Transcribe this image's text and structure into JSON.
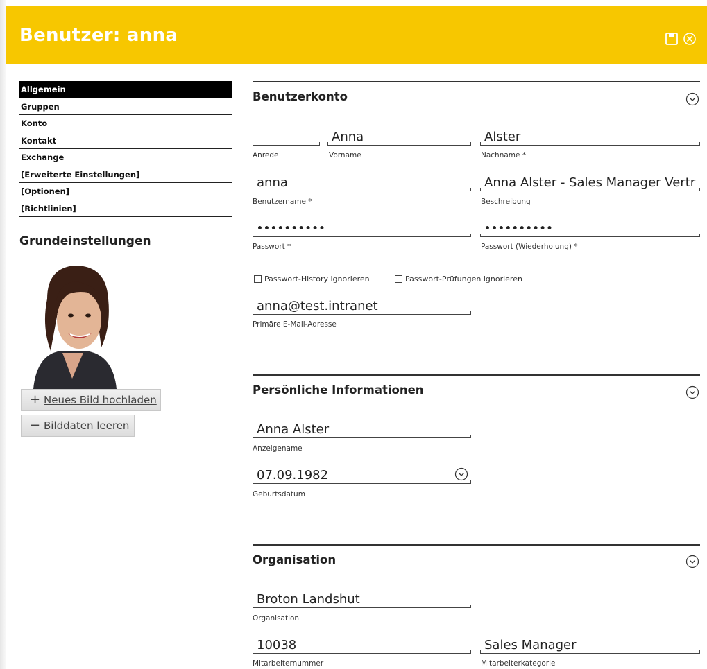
{
  "header": {
    "title": "Benutzer: anna",
    "save_icon": "save-icon",
    "close_icon": "close-icon",
    "color": "#f7c700"
  },
  "nav": {
    "items": [
      "Allgemein",
      "Gruppen",
      "Konto",
      "Kontakt",
      "Exchange",
      "[Erweiterte Einstellungen]",
      "[Optionen]",
      "[Richtlinien]"
    ],
    "active": "Allgemein"
  },
  "left": {
    "section_title": "Grundeinstellungen",
    "upload_label": "Neues Bild hochladen",
    "clear_label": "Bilddaten leeren"
  },
  "benutzerkonto": {
    "title": "Benutzerkonto",
    "anrede": {
      "value": "",
      "label": "Anrede"
    },
    "vorname": {
      "value": "Anna",
      "label": "Vorname"
    },
    "nachname": {
      "value": "Alster",
      "label": "Nachname *"
    },
    "benutzername": {
      "value": "anna",
      "label": "Benutzername *"
    },
    "beschreibung": {
      "value": "Anna Alster - Sales Manager Vertr",
      "label": "Beschreibung"
    },
    "passwort": {
      "value": "••••••••••",
      "label": "Passwort *"
    },
    "passwort2": {
      "value": "••••••••••",
      "label": "Passwort (Wiederholung) *"
    },
    "chk_history": "Passwort-History ignorieren",
    "chk_pruefungen": "Passwort-Prüfungen ignorieren",
    "email": {
      "value": "anna@test.intranet",
      "label": "Primäre E-Mail-Adresse"
    }
  },
  "persoenlich": {
    "title": "Persönliche Informationen",
    "anzeigename": {
      "value": "Anna Alster",
      "label": "Anzeigename"
    },
    "geburtsdatum": {
      "value": "07.09.1982",
      "label": "Geburtsdatum"
    }
  },
  "organisation": {
    "title": "Organisation",
    "organisation": {
      "value": "Broton Landshut",
      "label": "Organisation"
    },
    "mitarbeiternummer": {
      "value": "10038",
      "label": "Mitarbeiternummer"
    },
    "mitarbeiterkategorie": {
      "value": "Sales Manager",
      "label": "Mitarbeiterkategorie"
    }
  }
}
